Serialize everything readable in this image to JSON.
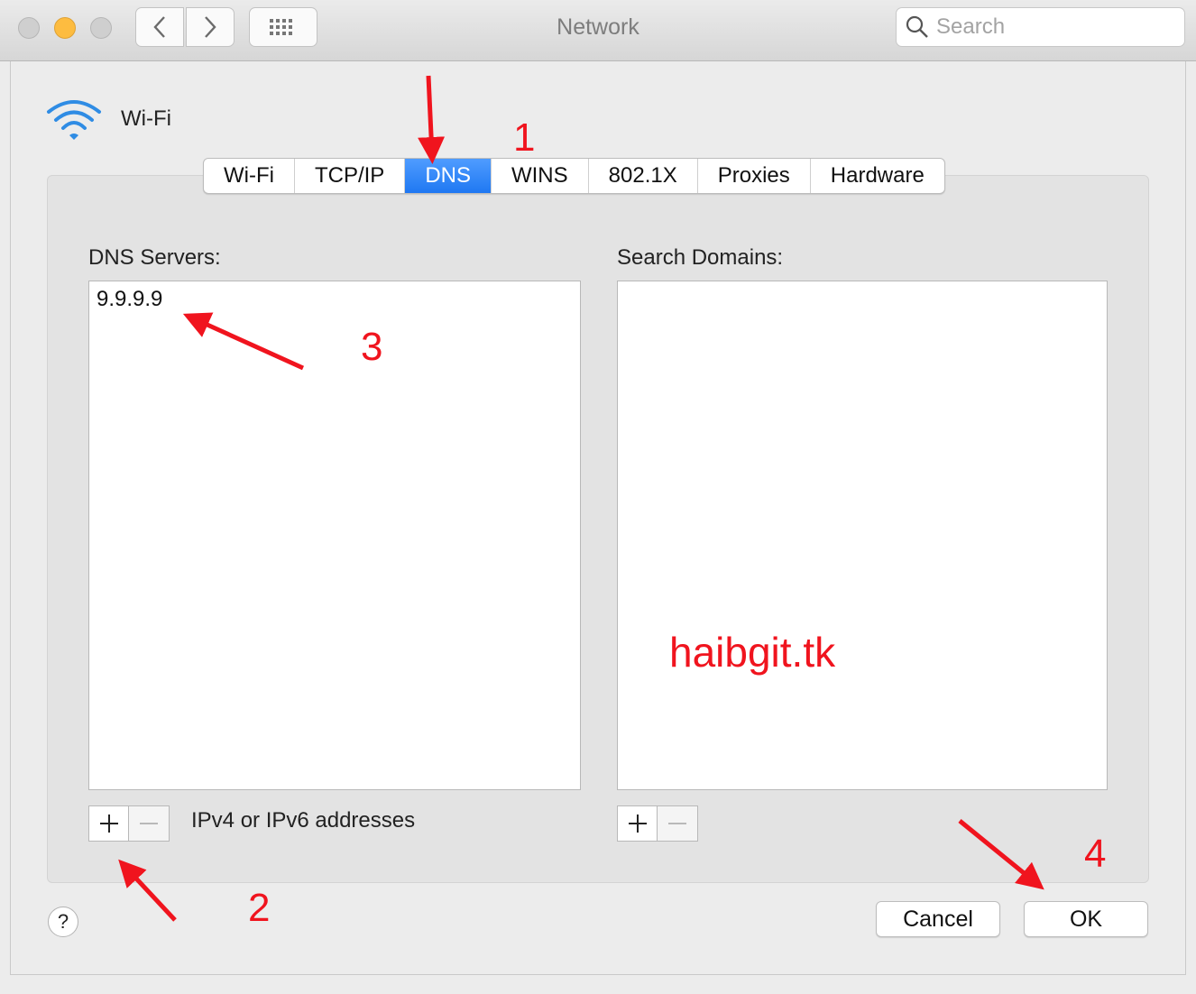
{
  "window": {
    "title": "Network",
    "search_placeholder": "Search"
  },
  "interface": {
    "name": "Wi-Fi"
  },
  "tabs": [
    {
      "label": "Wi-Fi",
      "active": false
    },
    {
      "label": "TCP/IP",
      "active": false
    },
    {
      "label": "DNS",
      "active": true
    },
    {
      "label": "WINS",
      "active": false
    },
    {
      "label": "802.1X",
      "active": false
    },
    {
      "label": "Proxies",
      "active": false
    },
    {
      "label": "Hardware",
      "active": false
    }
  ],
  "dns": {
    "servers_label": "DNS Servers:",
    "servers": [
      "9.9.9.9"
    ],
    "hint": "IPv4 or IPv6 addresses"
  },
  "search_domains": {
    "label": "Search Domains:"
  },
  "buttons": {
    "help": "?",
    "cancel": "Cancel",
    "ok": "OK"
  },
  "annotations": {
    "step1": "1",
    "step2": "2",
    "step3": "3",
    "step4": "4",
    "watermark": "haibgit.tk",
    "color": "#f0141e"
  },
  "colors": {
    "accent": "#1f78f2",
    "minimize": "#fdbc40"
  }
}
